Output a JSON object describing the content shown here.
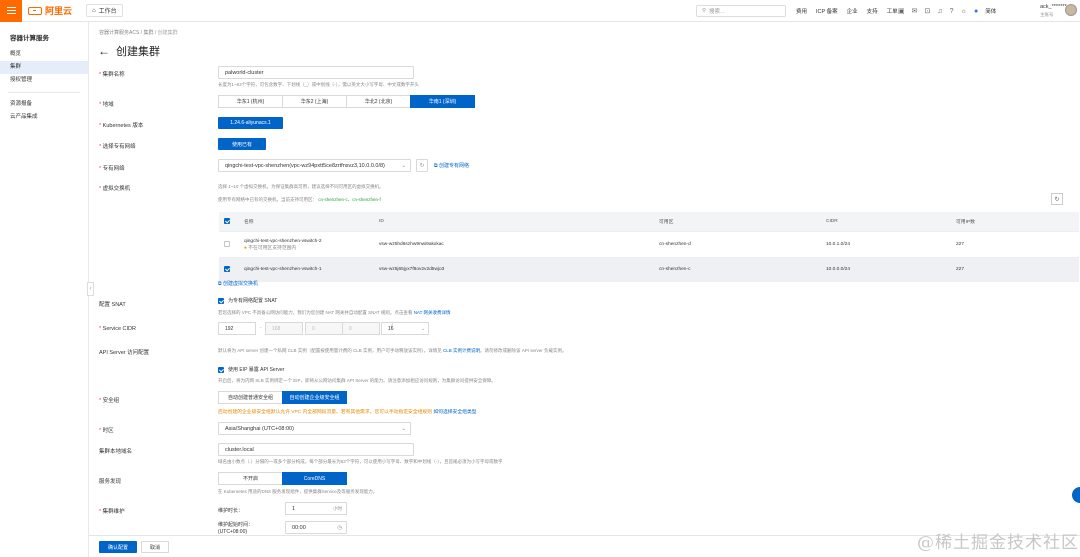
{
  "topbar": {
    "brand": "阿里云",
    "workspace": "工作台",
    "search_placeholder": "搜索...",
    "nav": [
      "费用",
      "ICP 备案",
      "企业",
      "支持",
      "工单"
    ],
    "account_name": "ack_*******",
    "account_sub": "主账号",
    "lang": "简体"
  },
  "sidebar": {
    "title": "容器计算服务",
    "items": [
      "概览",
      "集群",
      "授权管理"
    ],
    "items2": [
      "资源报备",
      "云产品集成"
    ]
  },
  "breadcrumb": [
    "容器计算服务ACS",
    "集群",
    "创建集群"
  ],
  "page_title": "创建集群",
  "form": {
    "cluster_name_label": "集群名称",
    "cluster_name_value": "palworld-cluster",
    "cluster_name_hint": "长度为1~63个字符，可包含数字、下划线（_）或中划线（-），需以英文大小写字母、中文或数字开头",
    "region_label": "地域",
    "regions": [
      "华东1 (杭州)",
      "华东2 (上海)",
      "华北2 (北京)",
      "华南1 (深圳)"
    ],
    "k8s_label": "Kubernetes 版本",
    "k8s_value": "1.24.6-aliyunacs.1",
    "vpc_choose_label": "选择专有网络",
    "vpc_choose_value": "使用已有",
    "vpc_label": "专有网络",
    "vpc_value": "qingchi-test-vpc-shenzhen(vpc-wz94pxtt5ce8zrtfnsvz3,10.0.0.0/8)",
    "vpc_create_link": "创建专有网络",
    "vswitch_label": "虚拟交换机",
    "vswitch_hint1": "选择 1~10 个虚拟交换机，为保证集群高可用，建议选择不同可用区的虚拟交换机。",
    "vswitch_hint2": "使用专有网络中已有的交换机，当前支持可用区：",
    "vswitch_zones": "cn-shenzhen-c、cn-shenzhen-f",
    "vswitch_create_link": "创建虚拟交换机",
    "snat_label": "配置 SNAT",
    "snat_check": "为专有网络配置 SNAT",
    "snat_hint": "若您选择的 VPC 不具备公网访问能力，我们为您创建 NAT 网关并自动配置 SNAT 规则。点击查看",
    "snat_link": "NAT 网关收费详情",
    "cidr_label": "Service CIDR",
    "cidr": [
      "192",
      "168",
      "0",
      "0",
      "16"
    ],
    "apiserver_label": "API Server 访问配置",
    "apiserver_hint": "默认将为 API server 创建一个私网 CLB 实例（配置按使用量计费的 CLB 实例，用户可手动释放该实例）。详情见",
    "apiserver_link": "CLB 实例计费说明",
    "apiserver_hint2": "。请勿修改或删除该 API server 负载实例。",
    "eip_check": "使用 EIP 暴露 API Server",
    "eip_hint": "开启后，将为内网 SLB 实例绑定一个 EIP，即将从公网访问集群 API Server 的能力。请注意添加相应访问规则，为集群访问提供安全保障。",
    "sg_label": "安全组",
    "sg_options": [
      "自动创建普通安全组",
      "自动创建企业级安全组"
    ],
    "sg_warn": "启动创建的企业级安全组默认允许 VPC 内全部网段流量。若有其他需求，您可以手动指定安全组规则",
    "sg_link": "如何选择安全组类型",
    "tz_label": "时区",
    "tz_value": "Asia/Shanghai (UTC+08:00)",
    "domain_label": "集群本地域名",
    "domain_value": "cluster.local",
    "domain_hint": "域名由小数点（.）分隔的一或多个部分构成，每个部分最长为63个字符，可以使用小写字母、数字和中划线（-），且首尾必须为小写字母或数字",
    "sd_label": "服务发现",
    "sd_options": [
      "不开启",
      "CoreDNS"
    ],
    "sd_hint": "在 Kubernetes 用途的DNS 服务发现组件，提供集群Service及等服务发现能力。",
    "maint_label": "集群维护",
    "maint_duration_label": "维护时长：",
    "maint_duration_value": "1",
    "maint_duration_unit": "小时",
    "maint_start_label": "维护起始时间：",
    "maint_start_tz": "(UTC+08:00)",
    "maint_start_value": "00:00"
  },
  "vswitch_table": {
    "headers": [
      "名称",
      "ID",
      "可用区",
      "CIDR",
      "可用IP数"
    ],
    "rows": [
      {
        "name": "qingchi-test-vpc-shenzhen-vswitch-2",
        "note": "不在可用区支持范围内",
        "id": "vsw-wz5hd6szhw9nwi9akxkac",
        "zone": "cn-shenzhen-d",
        "cidr": "10.0.1.0/24",
        "ips": "227"
      },
      {
        "name": "qingchi-test-vpc-shenzhen-vswitch-1",
        "note": "",
        "id": "vsw-wz5j65jyx7f8ov2v2d5wjo3",
        "zone": "cn-shenzhen-c",
        "cidr": "10.0.0.0/24",
        "ips": "227"
      }
    ]
  },
  "footer": {
    "confirm": "确认配置",
    "cancel": "取消"
  },
  "watermark": "@稀土掘金技术社区",
  "colors": {
    "brand": "#ff6a00",
    "primary": "#0064c8"
  }
}
